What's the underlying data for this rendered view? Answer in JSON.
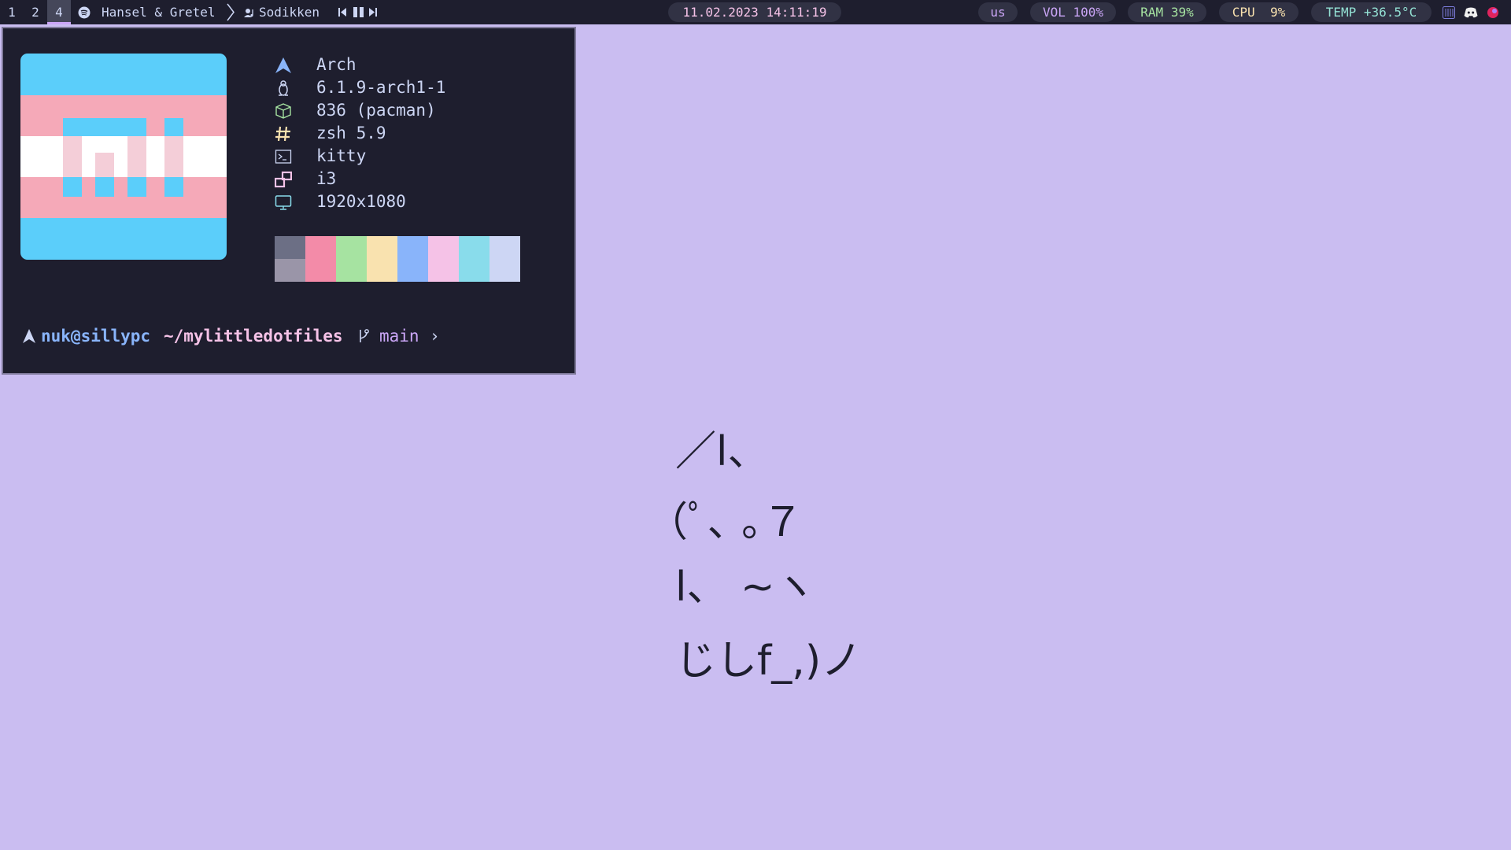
{
  "workspaces": [
    {
      "label": "1",
      "active": false
    },
    {
      "label": "2",
      "active": false
    },
    {
      "label": "4",
      "active": true
    }
  ],
  "media": {
    "icon": "spotify-icon",
    "track": "Hansel & Gretel",
    "artist_icon": "artist-icon",
    "artist": "Sodikken",
    "controls": [
      "previous-icon",
      "pause-icon",
      "next-icon"
    ]
  },
  "datetime": "11.02.2023 14:11:19",
  "status": {
    "keyboard_layout": "us",
    "volume_label": "VOL",
    "volume_value": "100%",
    "ram_label": "RAM",
    "ram_value": "39%",
    "cpu_label": "CPU",
    "cpu_value": "9%",
    "temp_label": "TEMP",
    "temp_value": "+36.5°C"
  },
  "tray": [
    "text-editor-icon",
    "discord-icon",
    "app-icon"
  ],
  "terminal": {
    "sysinfo": [
      {
        "icon": "arch-icon",
        "text": "Arch"
      },
      {
        "icon": "linux-tux-icon",
        "text": "6.1.9-arch1-1"
      },
      {
        "icon": "package-icon",
        "text": "836 (pacman)"
      },
      {
        "icon": "hash-icon",
        "text": "zsh 5.9"
      },
      {
        "icon": "terminal-icon",
        "text": "kitty"
      },
      {
        "icon": "windows-icon",
        "text": "i3"
      },
      {
        "icon": "monitor-icon",
        "text": "1920x1080"
      }
    ],
    "palette_top": [
      "#6c6f85",
      "#f38ba8",
      "#a6e3a1",
      "#f9e2af",
      "#89b4fa",
      "#f5c2e7",
      "#89dceb",
      "#cdd6f4"
    ],
    "palette_bottom": [
      "#9a95a8",
      "#f38ba8",
      "#a6e3a1",
      "#f9e2af",
      "#89b4fa",
      "#f5c2e7",
      "#89dceb",
      "#cdd6f4"
    ],
    "prompt": {
      "user_host": "nuk@sillypc",
      "path": "~/mylittledotfiles",
      "branch_icon": "git-branch-icon",
      "branch": "main",
      "caret": "›"
    }
  },
  "kaomoji": [
    "／l、",
    "（ﾟ､ ｡７",
    "l、 ~ヽ",
    "じしf_,)ノ"
  ],
  "colors": {
    "bar_bg": "#1e1e2e",
    "pill_bg": "#313244",
    "accent": "#cba6f7",
    "green": "#a6e3a1",
    "blue": "#89b4fa",
    "pink": "#f5c2e7",
    "yellow": "#f9e2af",
    "teal": "#94e2d5",
    "desktop_bg": "#cabdf1",
    "flag_blue": "#5bcefa",
    "flag_pink": "#f5a9b8",
    "flag_white": "#ffffff"
  }
}
